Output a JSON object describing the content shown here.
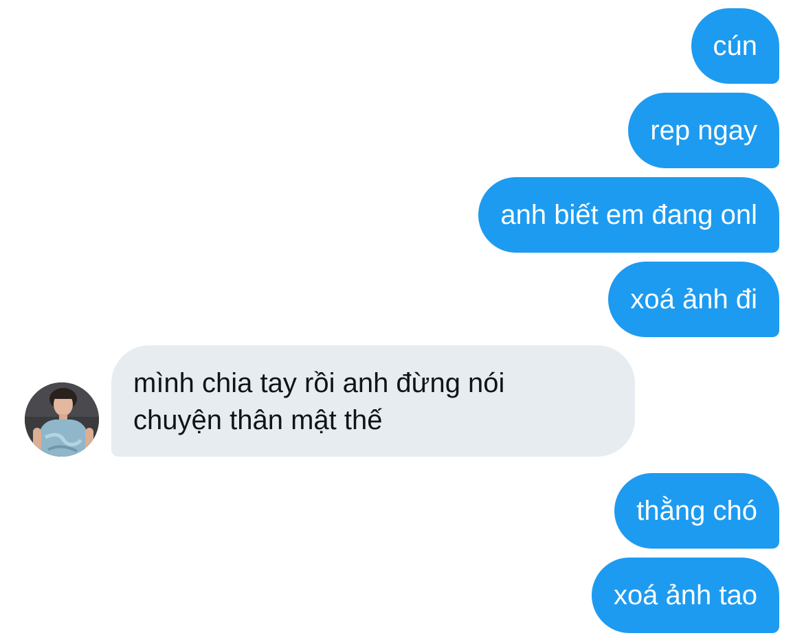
{
  "conversation": {
    "messages": [
      {
        "direction": "outgoing",
        "text": "cún"
      },
      {
        "direction": "outgoing",
        "text": "rep ngay"
      },
      {
        "direction": "outgoing",
        "text": "anh biết em đang onl"
      },
      {
        "direction": "outgoing",
        "text": "xoá ảnh đi"
      },
      {
        "direction": "incoming",
        "lines": [
          "mình chia tay rồi anh đừng nói",
          "chuyện thân mật thế"
        ]
      },
      {
        "direction": "outgoing",
        "text": "thằng chó"
      },
      {
        "direction": "outgoing",
        "text": "xoá ảnh tao"
      }
    ]
  },
  "colors": {
    "outgoing_bubble": "#1d9bf0",
    "incoming_bubble": "#e7ecf0",
    "outgoing_text": "#ffffff",
    "incoming_text": "#0f1419"
  },
  "icons": {
    "avatar": "user-avatar-photo"
  }
}
